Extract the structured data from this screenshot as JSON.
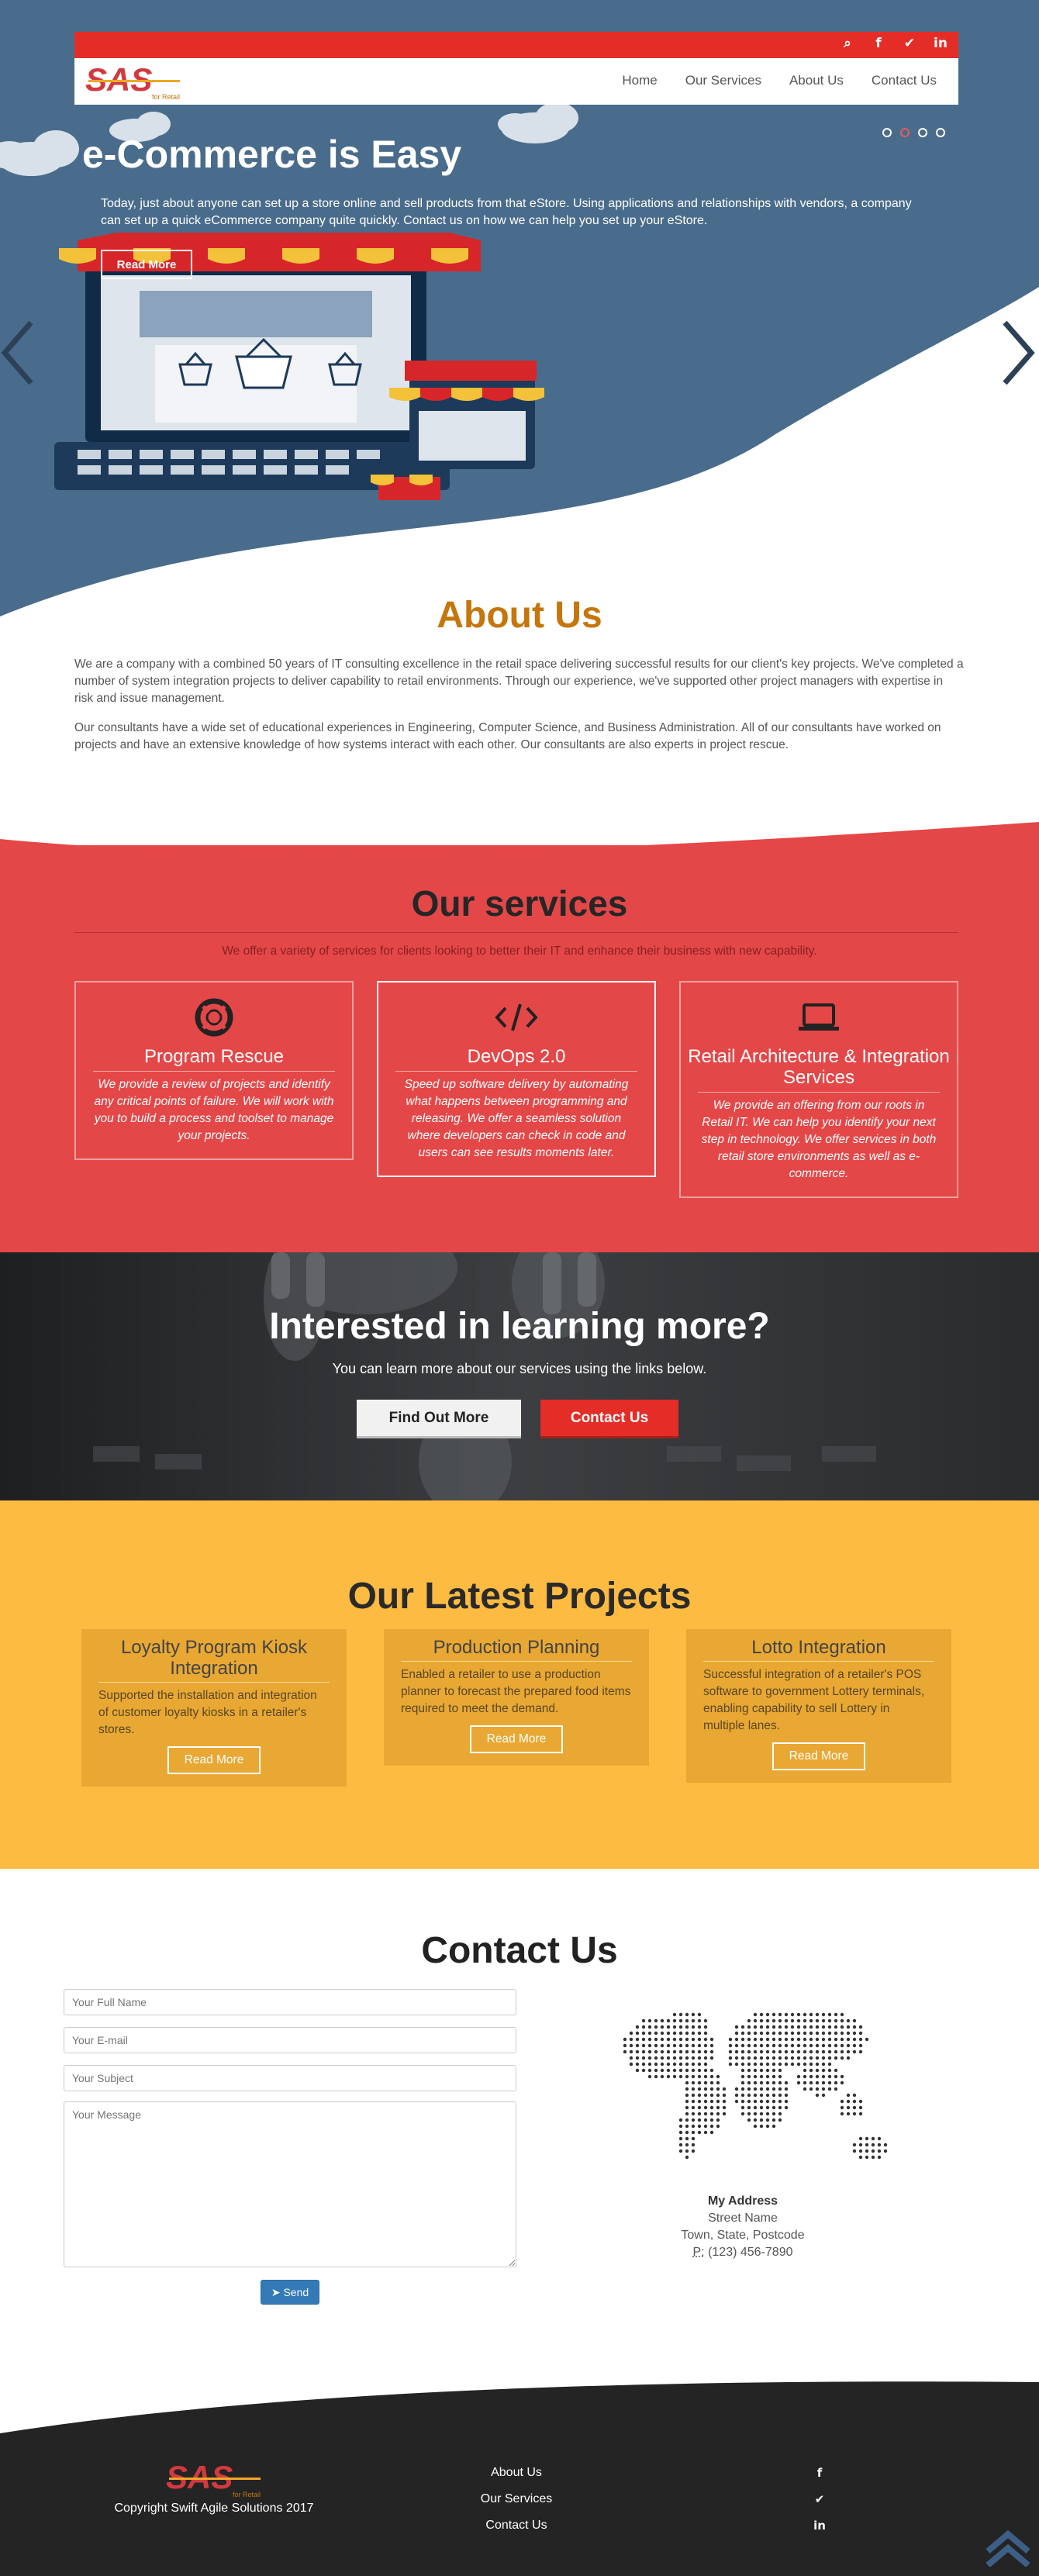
{
  "topbar": {
    "icons": [
      "search-icon",
      "facebook-icon",
      "twitter-icon",
      "linkedin-icon"
    ],
    "glyphs": [
      "⌕",
      "f",
      "✔",
      "in"
    ],
    "color": "#e52d27"
  },
  "logo": {
    "text": "SAS",
    "tagline": "for Retail"
  },
  "nav": {
    "items": [
      "Home",
      "Our Services",
      "About Us",
      "Contact Us"
    ]
  },
  "hero": {
    "title": "e-Commerce is Easy",
    "text": "Today, just about anyone can set up a store online and sell products from that eStore. Using applications and relationships with vendors, a company can set up a quick eCommerce company quite quickly. Contact us on how we can help you set up your eStore.",
    "button": "Read More",
    "slides": 4,
    "active_slide": 2,
    "background": "#4a6c8c"
  },
  "about": {
    "title": "About Us",
    "p1": "We are a company with a combined 50 years of IT consulting excellence in the retail space delivering successful results for our client's key projects. We've completed a number of system integration projects to deliver capability to retail environments. Through our experience, we've supported other project managers with expertise in risk and issue management.",
    "p2": "Our consultants have a wide set of educational experiences in Engineering, Computer Science, and Business Administration. All of our consultants have worked on projects and have an extensive knowledge of how systems interact with each other. Our consultants are also experts in project rescue."
  },
  "services": {
    "title": "Our services",
    "subtitle": "We offer a variety of services for clients looking to better their IT and enhance their business with new capability.",
    "background": "#e44748",
    "cards": [
      {
        "icon": "life-ring-icon",
        "title": "Program Rescue",
        "text": "We provide a review of projects and identify any critical points of failure. We will work with you to build a process and toolset to manage your projects."
      },
      {
        "icon": "code-icon",
        "title": "DevOps 2.0",
        "text": "Speed up software delivery by automating what happens between programming and releasing. We offer a seamless solution where developers can check in code and users can see results moments later."
      },
      {
        "icon": "laptop-icon",
        "title": "Retail Architecture & Integration Services",
        "text": "We provide an offering from our roots in Retail IT. We can help you identify your next step in technology. We offer services in both retail store environments as well as e-commerce."
      }
    ]
  },
  "cta": {
    "title": "Interested in learning more?",
    "subtitle": "You can learn more about our services using the links below.",
    "find_button": "Find Out More",
    "contact_button": "Contact Us"
  },
  "projects": {
    "title": "Our Latest Projects",
    "background": "#fdbb41",
    "items": [
      {
        "title": "Loyalty Program Kiosk Integration",
        "text": "Supported the installation and integration of customer loyalty kiosks in a retailer's stores.",
        "button": "Read More"
      },
      {
        "title": "Production Planning",
        "text": "Enabled a retailer to use a production planner to forecast the prepared food items required to meet the demand.",
        "button": "Read More"
      },
      {
        "title": "Lotto Integration",
        "text": "Successful integration of a retailer's POS software to government Lottery terminals, enabling capability to sell Lottery in multiple lanes.",
        "button": "Read More"
      }
    ]
  },
  "contact": {
    "title": "Contact Us",
    "name_placeholder": "Your Full Name",
    "email_placeholder": "Your E-mail",
    "subject_placeholder": "Your Subject",
    "message_placeholder": "Your Message",
    "send_button": "Send",
    "address": {
      "heading": "My Address",
      "line1": "Street Name",
      "line2": "Town, State, Postcode",
      "phone_label": "P:",
      "phone": "(123) 456-7890"
    }
  },
  "footer": {
    "copyright": "Copyright Swift Agile Solutions 2017",
    "links": [
      "About Us",
      "Our Services",
      "Contact Us"
    ],
    "social": [
      "facebook-icon",
      "twitter-icon",
      "linkedin-icon"
    ],
    "social_glyphs": [
      "f",
      "✔",
      "in"
    ],
    "background": "#242424"
  }
}
